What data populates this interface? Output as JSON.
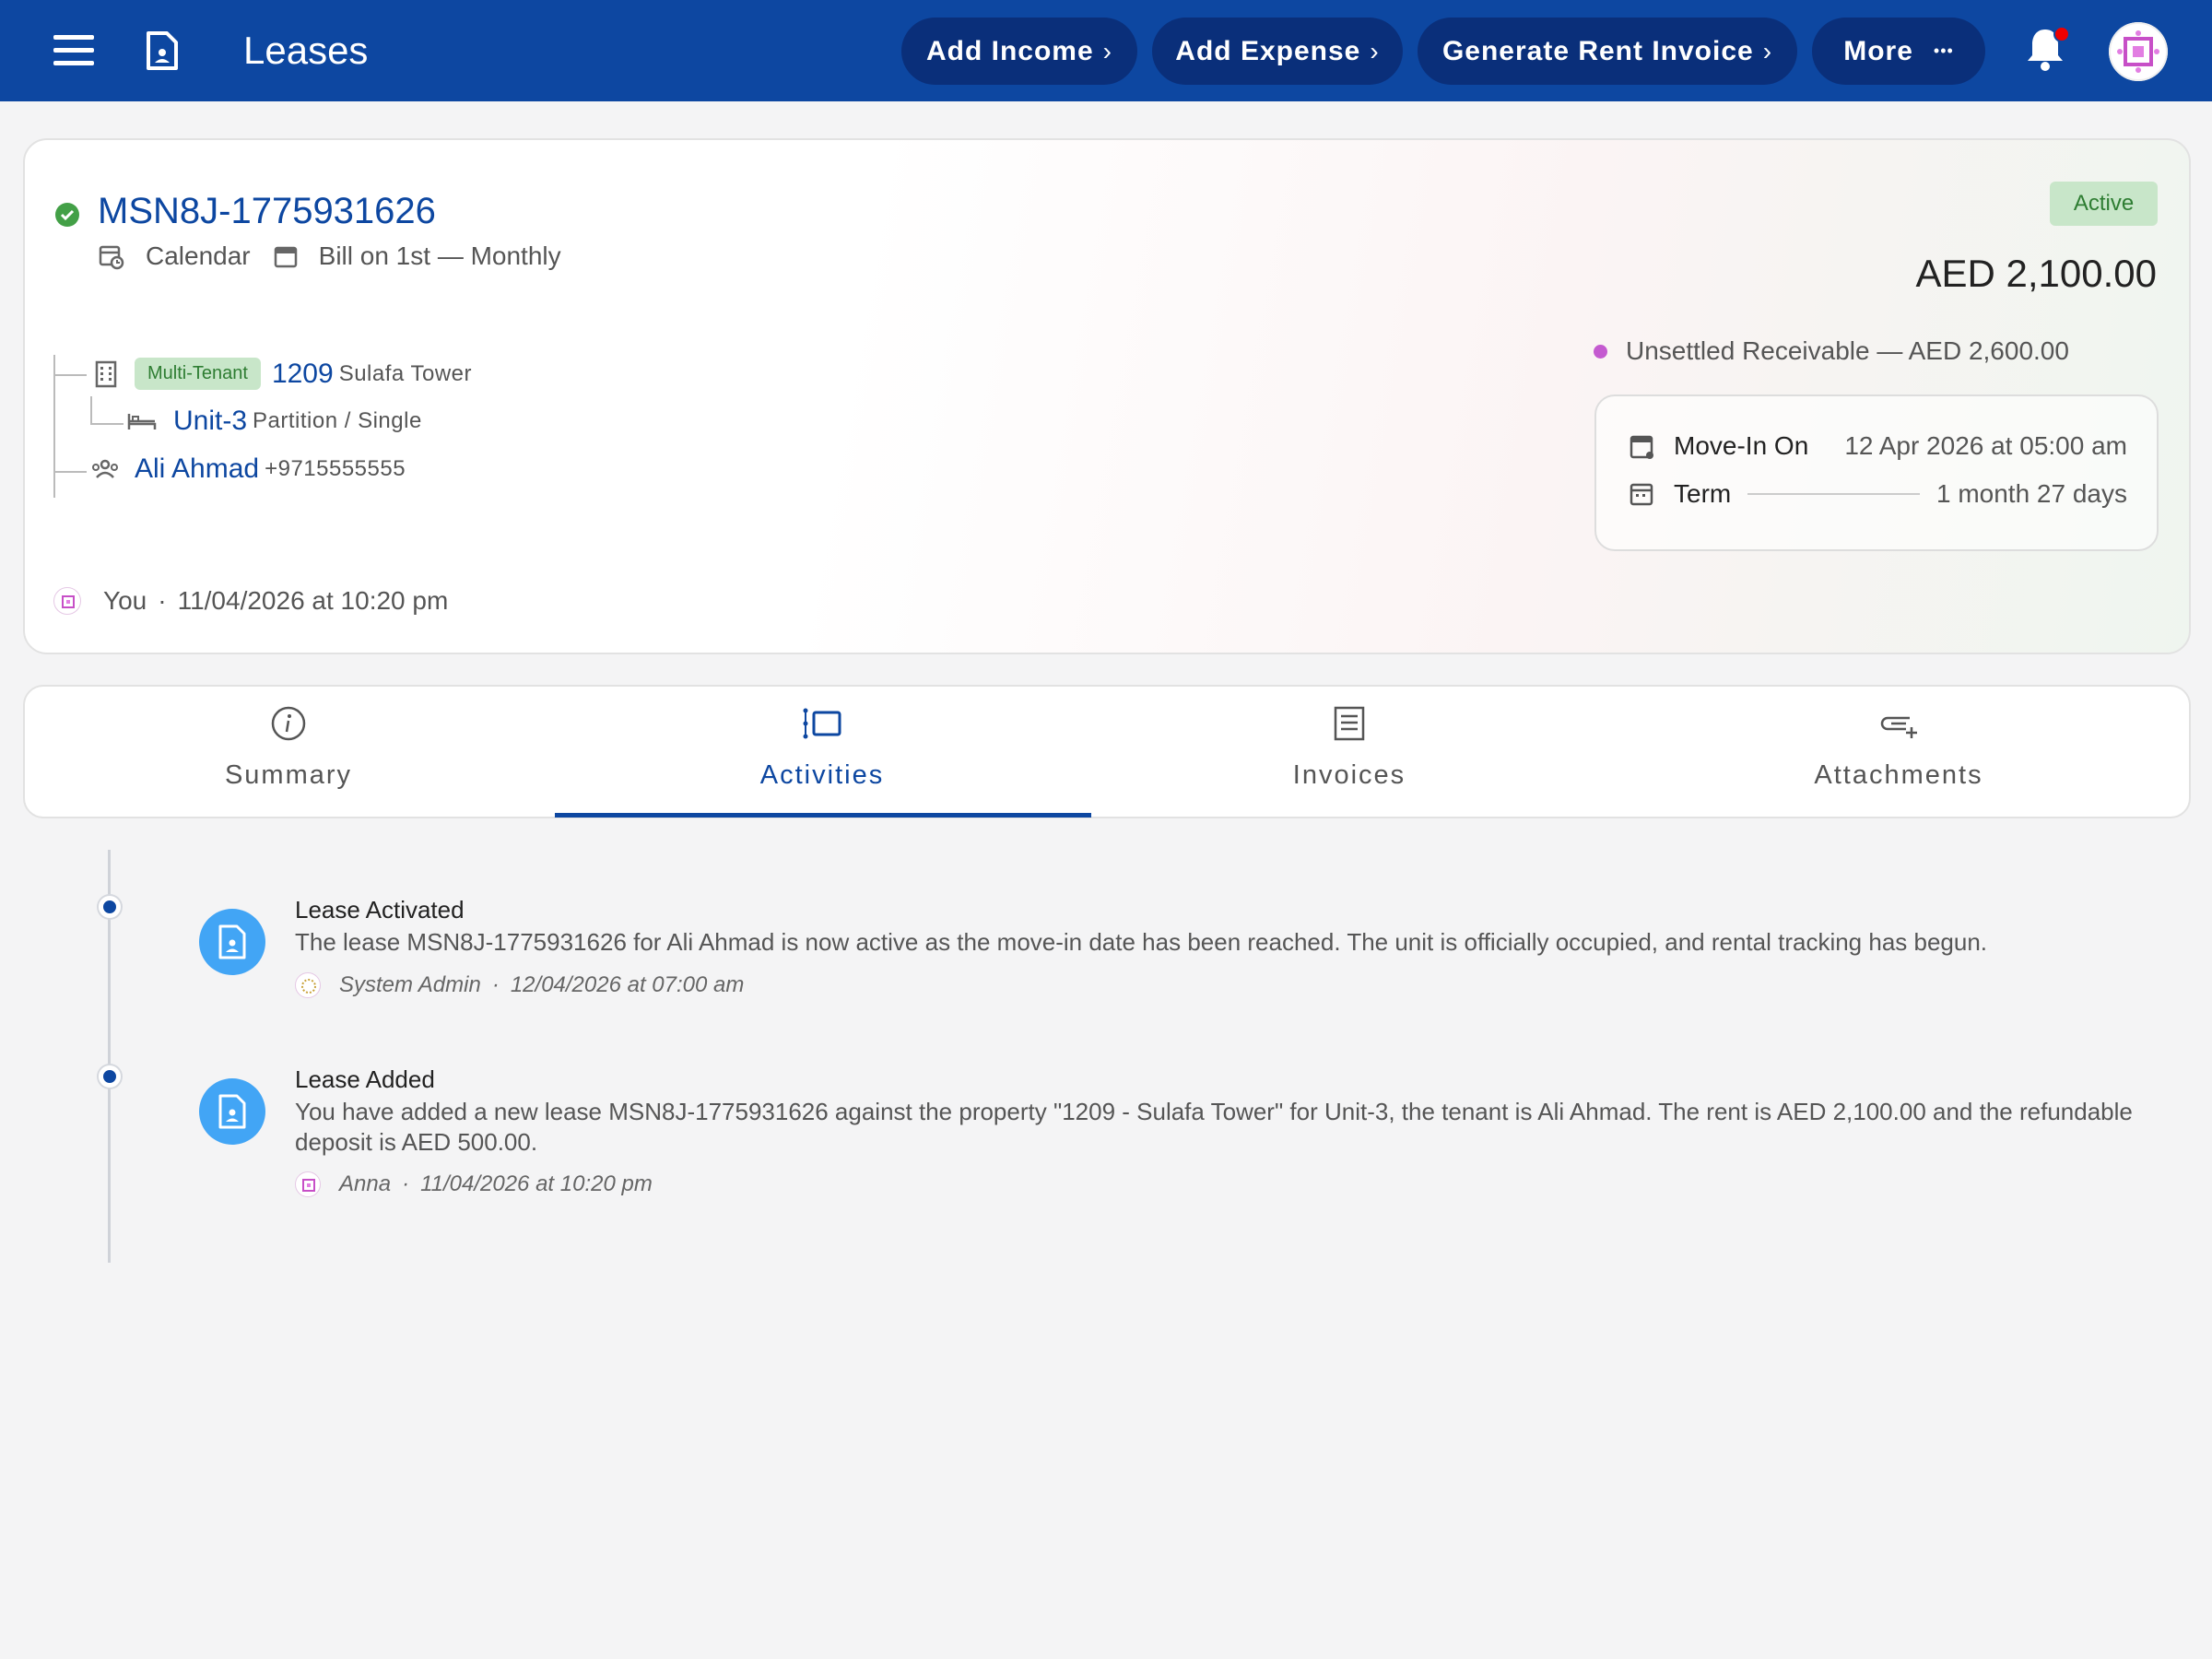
{
  "header": {
    "title": "Leases",
    "actions": [
      {
        "label": "Add Income",
        "chevron": "›"
      },
      {
        "label": "Add Expense",
        "chevron": "›"
      },
      {
        "label": "Generate Rent Invoice",
        "chevron": "›"
      },
      {
        "label": "More",
        "chevron": "•••"
      }
    ],
    "accent_color": "#0d47a1"
  },
  "lease": {
    "id": "MSN8J-1775931626",
    "calendar_type": "Calendar",
    "billing": "Bill on 1st — Monthly",
    "status": "Active",
    "amount": "AED 2,100.00",
    "property": {
      "tag": "Multi-Tenant",
      "number": "1209",
      "name": "Sulafa Tower"
    },
    "unit": {
      "name": "Unit-3",
      "detail": "Partition / Single"
    },
    "tenant": {
      "name": "Ali Ahmad",
      "phone": "+9715555555"
    },
    "created_by": "You",
    "created_at": "11/04/2026 at 10:20 pm",
    "receivable": "Unsettled Receivable — AED 2,600.00",
    "move_in_label": "Move-In On",
    "move_in_value": "12 Apr 2026 at 05:00 am",
    "term_label": "Term",
    "term_value": "1 month 27 days"
  },
  "tabs": [
    {
      "label": "Summary",
      "icon": "info-icon"
    },
    {
      "label": "Activities",
      "icon": "activities-icon",
      "active": true
    },
    {
      "label": "Invoices",
      "icon": "invoice-icon"
    },
    {
      "label": "Attachments",
      "icon": "attachment-add-icon"
    }
  ],
  "activities": [
    {
      "title": "Lease Activated",
      "description": "The lease MSN8J-1775931626 for Ali Ahmad is now active as the move-in date has been reached. The unit is officially occupied, and rental tracking has begun.",
      "author": "System Admin",
      "timestamp": "12/04/2026 at 07:00 am"
    },
    {
      "title": "Lease Added",
      "description": "You have added a new lease MSN8J-1775931626 against the property \"1209 - Sulafa Tower\" for Unit-3, the tenant is Ali Ahmad. The rent is AED 2,100.00 and the refundable deposit is AED 500.00.",
      "author": "Anna",
      "timestamp": "11/04/2026 at 10:20 pm"
    }
  ]
}
